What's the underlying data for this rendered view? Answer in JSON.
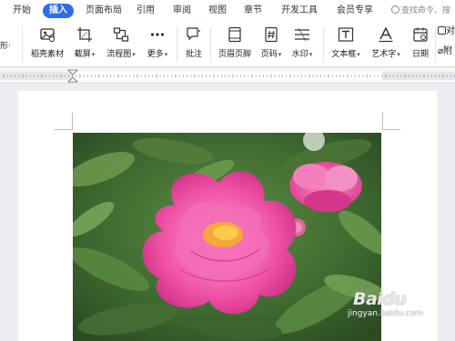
{
  "menu": {
    "tabs": [
      {
        "label": "开始",
        "active": false
      },
      {
        "label": "插入",
        "active": true
      },
      {
        "label": "页面布局",
        "active": false
      },
      {
        "label": "引用",
        "active": false
      },
      {
        "label": "审阅",
        "active": false
      },
      {
        "label": "视图",
        "active": false
      },
      {
        "label": "章节",
        "active": false
      },
      {
        "label": "开发工具",
        "active": false
      },
      {
        "label": "会员专享",
        "active": false
      }
    ],
    "search_placeholder": "查找命令、搜"
  },
  "ribbon": {
    "left_cut_label": "形·",
    "buttons": [
      {
        "label": "稻壳素材",
        "icon": "docer-material-icon",
        "dropdown": false
      },
      {
        "label": "截屏",
        "icon": "screenshot-icon",
        "dropdown": true
      },
      {
        "label": "流程图",
        "icon": "flowchart-icon",
        "dropdown": true
      },
      {
        "label": "更多",
        "icon": "more-icon",
        "dropdown": true
      },
      {
        "label": "批注",
        "icon": "comment-icon",
        "dropdown": false
      },
      {
        "label": "页眉页脚",
        "icon": "header-footer-icon",
        "dropdown": false
      },
      {
        "label": "页码",
        "icon": "page-number-icon",
        "dropdown": true
      },
      {
        "label": "水印",
        "icon": "watermark-icon",
        "dropdown": true
      },
      {
        "label": "文本框",
        "icon": "textbox-icon",
        "dropdown": true
      },
      {
        "label": "艺术字",
        "icon": "wordart-icon",
        "dropdown": true
      },
      {
        "label": "日期",
        "icon": "date-icon",
        "dropdown": false
      }
    ],
    "right_cut_top": "对",
    "right_cut_bottom": "附"
  },
  "document": {
    "image_description_icon": "peony-photo",
    "watermark": {
      "logo": "Baidu",
      "subtitle": "jingyan.baidu.com"
    }
  },
  "colors": {
    "accent": "#2f6dea",
    "ribbon_bg": "#ffffff",
    "canvas_bg": "#eceef1"
  }
}
